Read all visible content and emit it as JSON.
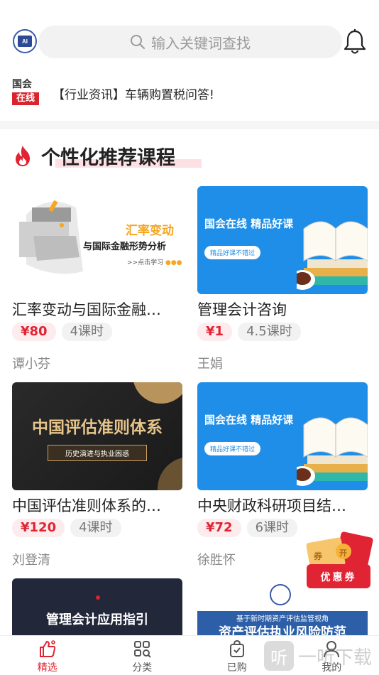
{
  "header": {
    "search_placeholder": "输入关键词查找"
  },
  "news": {
    "logo_line1": "国会",
    "logo_line2": "在线",
    "text": "【行业资讯】车辆购置税问答!"
  },
  "section": {
    "title": "个性化推荐课程"
  },
  "courses": [
    {
      "title": "汇率变动与国际金融…",
      "price": "¥80",
      "hours": "4课时",
      "teacher": "谭小芬",
      "thumb_line1": "汇率变动",
      "thumb_line2": "与国际金融形势分析",
      "thumb_line3": ">>点击学习"
    },
    {
      "title": "管理会计咨询",
      "price": "¥1",
      "hours": "4.5课时",
      "teacher": "王娟",
      "thumb_line1": "国会在线 精品好课",
      "thumb_line2": "精品好课不错过"
    },
    {
      "title": "中国评估准则体系的…",
      "price": "¥120",
      "hours": "4课时",
      "teacher": "刘登清",
      "thumb_line1": "中国评估准则体系",
      "thumb_line2": "历史演进与执业困惑"
    },
    {
      "title": "中央财政科研项目结…",
      "price": "¥72",
      "hours": "6课时",
      "teacher": "徐胜怀",
      "thumb_line1": "国会在线 精品好课",
      "thumb_line2": "精品好课不错过"
    },
    {
      "thumb_line1": "管理会计应用指引"
    },
    {
      "thumb_line1": "基于新时期资产评估监管视角",
      "thumb_line2": "资产评估执业风险防范"
    }
  ],
  "coupon": {
    "label": "优惠券",
    "chip1": "券",
    "chip2": "开"
  },
  "nav": [
    {
      "label": "精选",
      "icon": "thumbs-up-icon",
      "active": true
    },
    {
      "label": "分类",
      "icon": "category-grid-icon",
      "active": false
    },
    {
      "label": "已购",
      "icon": "purchased-bag-icon",
      "active": false
    },
    {
      "label": "我的",
      "icon": "user-icon",
      "active": false
    }
  ],
  "watermark": "一听下载",
  "colors": {
    "accent": "#e02433",
    "blue_thumb": "#1e8ee8",
    "search_bg": "#f2f2f2"
  }
}
